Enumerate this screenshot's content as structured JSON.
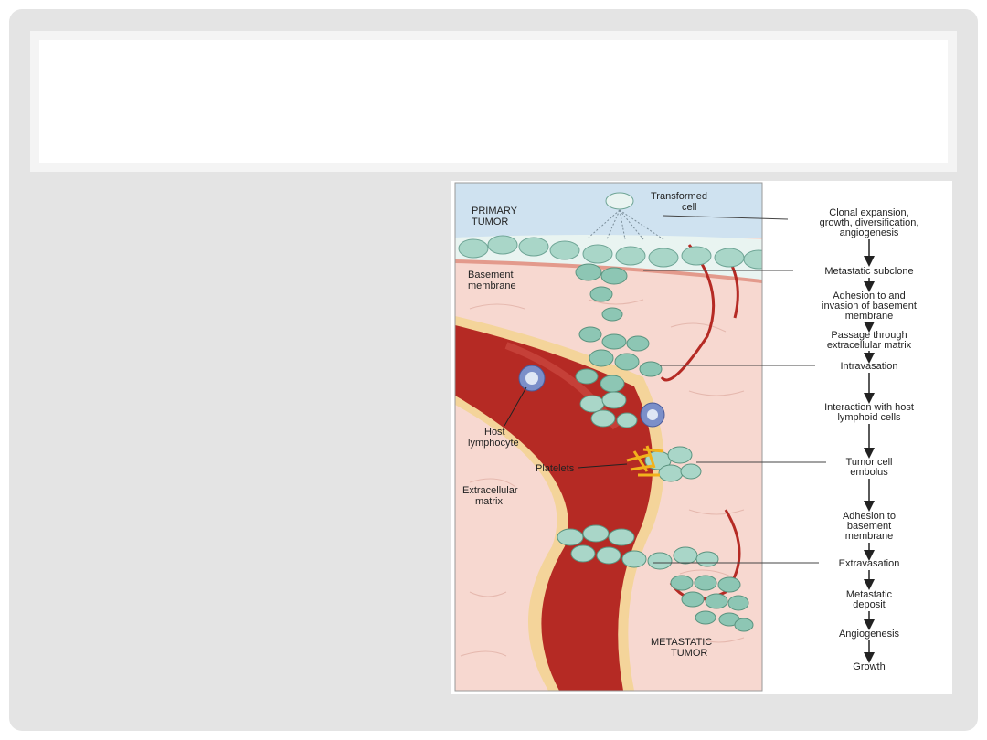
{
  "slide": {
    "title": ""
  },
  "illustration": {
    "primary_tumor": [
      "PRIMARY",
      "TUMOR"
    ],
    "transformed_cell": [
      "Transformed",
      "cell"
    ],
    "basement_membrane": [
      "Basement",
      "membrane"
    ],
    "host_lymphocyte": [
      "Host",
      "lymphocyte"
    ],
    "platelets": "Platelets",
    "extracellular_matrix": [
      "Extracellular",
      "matrix"
    ],
    "metastatic_tumor": [
      "METASTATIC",
      "TUMOR"
    ]
  },
  "steps": [
    {
      "lines": [
        "Clonal expansion,",
        "growth, diversification,",
        "angiogenesis"
      ]
    },
    {
      "lines": [
        "Metastatic subclone"
      ]
    },
    {
      "lines": [
        "Adhesion to and",
        "invasion of basement",
        "membrane"
      ]
    },
    {
      "lines": [
        "Passage through",
        "extracellular matrix"
      ]
    },
    {
      "lines": [
        "Intravasation"
      ]
    },
    {
      "lines": [
        "Interaction with host",
        "lymphoid cells"
      ]
    },
    {
      "lines": [
        "Tumor cell",
        "embolus"
      ]
    },
    {
      "lines": [
        "Adhesion to",
        "basement",
        "membrane"
      ]
    },
    {
      "lines": [
        "Extravasation"
      ]
    },
    {
      "lines": [
        "Metastatic",
        "deposit"
      ]
    },
    {
      "lines": [
        "Angiogenesis"
      ]
    },
    {
      "lines": [
        "Growth"
      ]
    }
  ],
  "colors": {
    "blood": "#b52a24",
    "tissue": "#f7d8d0",
    "tumor_cell": "#a9d6c8",
    "sky": "#cfe2f0",
    "platelet": "#f2b21c",
    "membrane": "#f4d49a"
  }
}
